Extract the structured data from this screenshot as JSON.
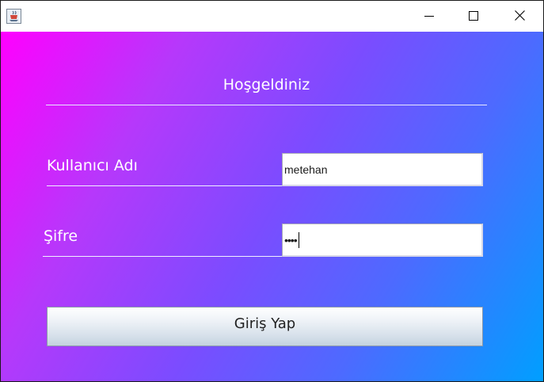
{
  "window": {
    "title": "",
    "app_icon": "java-cup-icon",
    "controls": {
      "minimize_icon": "minimize-icon",
      "maximize_icon": "maximize-icon",
      "close_icon": "close-icon"
    }
  },
  "form": {
    "heading": "Hoşgeldiniz",
    "username_label": "Kullanıcı Adı",
    "username_value": "metehan",
    "password_label": "Şifre",
    "password_masked": "••••",
    "submit_label": "Giriş Yap"
  },
  "colors": {
    "gradient_start": "#ff00ff",
    "gradient_end": "#009fff",
    "text_on_gradient": "#ffffff"
  }
}
